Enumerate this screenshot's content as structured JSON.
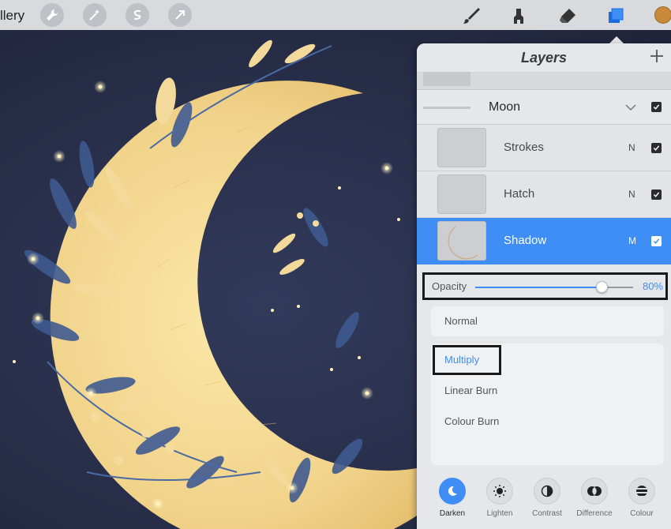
{
  "toolbar": {
    "gallery_label": "llery",
    "tools": [
      "wrench-icon",
      "magic-wand-icon",
      "selection-icon",
      "transform-icon"
    ],
    "right_tools": [
      "brush-icon",
      "smudge-icon",
      "eraser-icon",
      "layers-icon"
    ],
    "current_color": "#c8893a"
  },
  "layers_panel": {
    "title": "Layers",
    "group": {
      "name": "Moon",
      "visible": true
    },
    "layers": [
      {
        "name": "Strokes",
        "blend": "N",
        "visible": true,
        "active": false
      },
      {
        "name": "Hatch",
        "blend": "N",
        "visible": true,
        "active": false
      },
      {
        "name": "Shadow",
        "blend": "M",
        "visible": true,
        "active": true
      }
    ],
    "opacity": {
      "label": "Opacity",
      "value": 0.8,
      "display": "80%"
    },
    "current_mode": "Normal",
    "modes": [
      "Multiply",
      "Linear Burn",
      "Colour Burn"
    ],
    "selected_mode": "Multiply",
    "mode_groups": [
      {
        "label": "Darken",
        "icon": "moon-icon",
        "active": true
      },
      {
        "label": "Lighten",
        "icon": "sun-icon",
        "active": false
      },
      {
        "label": "Contrast",
        "icon": "half-circle-icon",
        "active": false
      },
      {
        "label": "Difference",
        "icon": "difference-icon",
        "active": false
      },
      {
        "label": "Colour",
        "icon": "stripes-icon",
        "active": false
      }
    ]
  },
  "colors": {
    "accent": "#3f8ef5",
    "canvas_bg": "#262c45",
    "moon": "#f2d58c"
  }
}
